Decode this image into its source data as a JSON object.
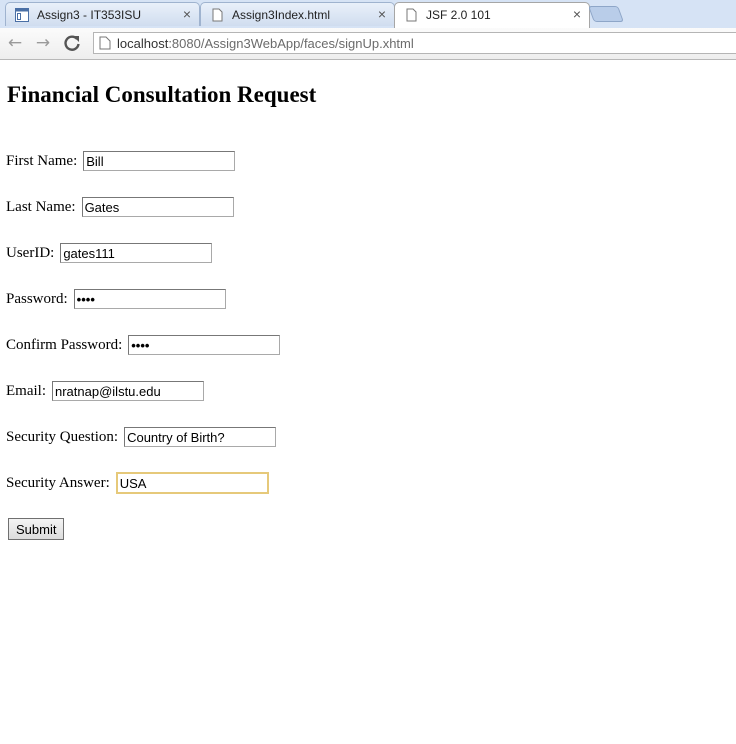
{
  "browser": {
    "tabs": [
      {
        "title": "Assign3 - IT353ISU",
        "icon": "window-icon",
        "close": "×"
      },
      {
        "title": "Assign3Index.html",
        "icon": "page-icon",
        "close": "×"
      },
      {
        "title": "JSF 2.0 101",
        "icon": "page-icon",
        "close": "×",
        "active": true
      }
    ],
    "nav": {
      "back": "←",
      "forward": "→",
      "reload": "C"
    },
    "url": {
      "host": "localhost",
      "rest": ":8080/Assign3WebApp/faces/signUp.xhtml"
    }
  },
  "page": {
    "title": "Financial Consultation Request",
    "fields": [
      {
        "label": "First Name:",
        "value": "Bill",
        "type": "text"
      },
      {
        "label": "Last Name:",
        "value": "Gates",
        "type": "text"
      },
      {
        "label": "UserID:",
        "value": "gates111",
        "type": "text"
      },
      {
        "label": "Password:",
        "value": "••••",
        "type": "password"
      },
      {
        "label": "Confirm Password:",
        "value": "••••",
        "type": "password"
      },
      {
        "label": "Email:",
        "value": "nratnap@ilstu.edu",
        "type": "text"
      },
      {
        "label": "Security Question:",
        "value": "Country of Birth?",
        "type": "text"
      },
      {
        "label": "Security Answer:",
        "value": "USA",
        "type": "text",
        "focused": true
      }
    ],
    "submit_label": "Submit"
  },
  "colors": {
    "tabstrip": "#d6e3f5",
    "focus_ring": "#e6c97a"
  }
}
